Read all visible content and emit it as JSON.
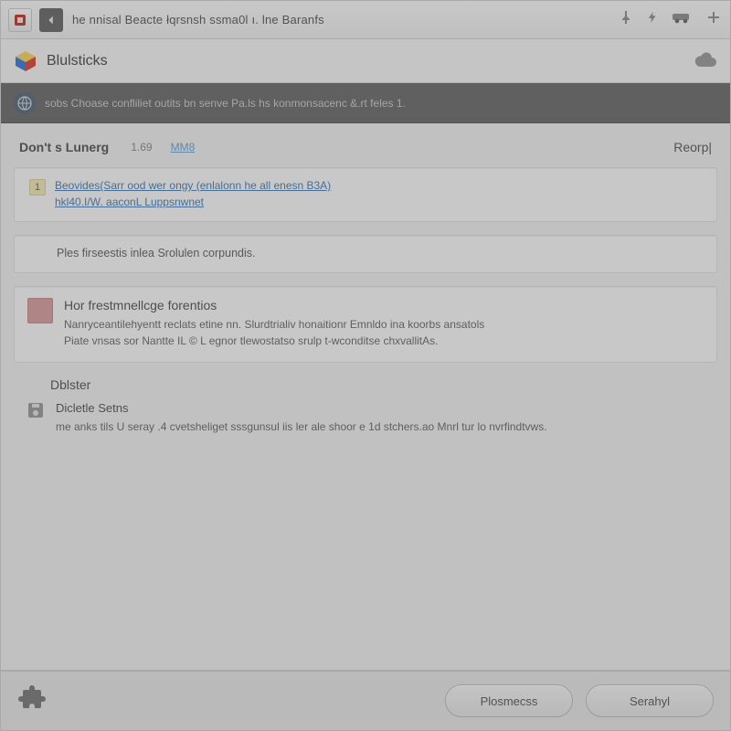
{
  "titlebar": {
    "title": "he nnisal Beacte łqrsnsh ssma0l ı. lne Baranfs"
  },
  "subheader": {
    "brand": "Blulsticks"
  },
  "noticebar": {
    "text": "sobs Choase confliliet outits bn senve Pa.ls hs konmonsacenc &.rt feles 1."
  },
  "panel": {
    "title": "Don't s Lunerg",
    "count": "1.69",
    "tab": "MM8",
    "right": "Reorp|"
  },
  "card1": {
    "badge": "1",
    "link1": "Beovides(Sarr ood wer ongy (enlalonn he all enesn B3A)",
    "link2": "hkl40.I/W. aaconL Luppsnwnet"
  },
  "card2": {
    "text": "Ples firseestis inlea Srolulen corpundis."
  },
  "card3": {
    "title": "Hor frestmnellcge forentios",
    "body1": "Nanryceantilehyentt reclats etine nn. Slurdtrialiv honaitionr Emnldo ina koorbs ansatols",
    "body2": "Piate vnsas sor Nantte IL © L egnor tlewostatso srulp t-wconditse chxvallitAs."
  },
  "section": {
    "label": "Dblster",
    "title": "Dicletle Setns",
    "body": "me anks tils U seray .4 cvetsheliget sssgunsul iis ler ale shoor e 1d stchers.ao Mnrl tur lo nvrfindtvws."
  },
  "footer": {
    "btn_left": "Plosmecss",
    "btn_right": "Serahyl"
  }
}
